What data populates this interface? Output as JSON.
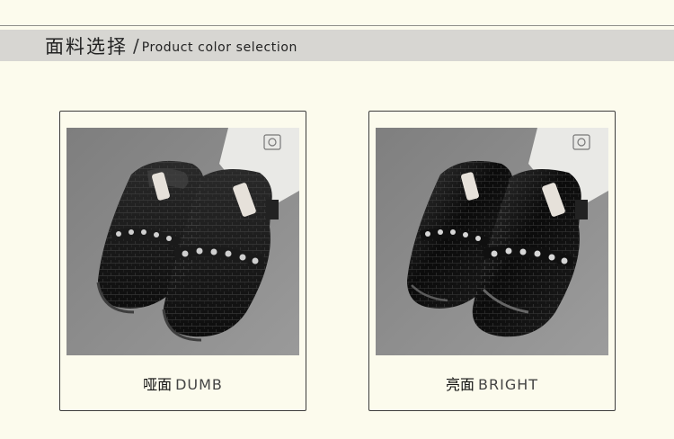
{
  "header": {
    "title_cn": "面料选择",
    "slash": "/",
    "title_en": "Product color selection"
  },
  "options": [
    {
      "name_cn": "哑面",
      "name_en": "DUMB",
      "finish": "matte"
    },
    {
      "name_cn": "亮面",
      "name_en": "BRIGHT",
      "finish": "glossy"
    }
  ],
  "colors": {
    "background": "#fcfbed",
    "header_bar": "#d7d6d2",
    "card_border": "#3c3c3c"
  }
}
